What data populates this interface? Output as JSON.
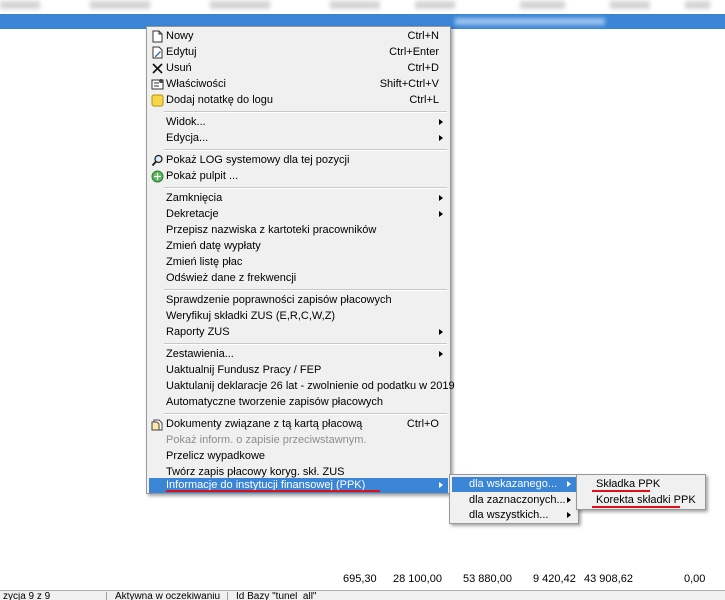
{
  "context_menu": {
    "items": [
      {
        "label": "Nowy",
        "shortcut": "Ctrl+N",
        "icon": "new-document-icon"
      },
      {
        "label": "Edytuj",
        "shortcut": "Ctrl+Enter",
        "icon": "edit-document-icon"
      },
      {
        "label": "Usuń",
        "shortcut": "Ctrl+D",
        "icon": "delete-x-icon"
      },
      {
        "label": "Właściwości",
        "shortcut": "Shift+Ctrl+V",
        "icon": "properties-icon"
      },
      {
        "label": "Dodaj notatkę do logu",
        "shortcut": "Ctrl+L",
        "icon": "note-icon"
      },
      {
        "label": "Widok...",
        "submenu": true
      },
      {
        "label": "Edycja...",
        "submenu": true
      },
      {
        "label": "Pokaż LOG systemowy dla tej pozycji",
        "icon": "magnifier-icon"
      },
      {
        "label": "Pokaż pulpit ...",
        "icon": "desktop-icon"
      },
      {
        "label": "Zamknięcia",
        "submenu": true
      },
      {
        "label": "Dekretacje",
        "submenu": true
      },
      {
        "label": "Przepisz nazwiska z kartoteki pracowników"
      },
      {
        "label": "Zmień datę wypłaty"
      },
      {
        "label": "Zmień listę płac"
      },
      {
        "label": "Odśwież dane z frekwencji"
      },
      {
        "label": "Sprawdzenie poprawności zapisów płacowych"
      },
      {
        "label": "Weryfikuj składki ZUS (E,R,C,W,Z)"
      },
      {
        "label": "Raporty ZUS",
        "submenu": true
      },
      {
        "label": "Zestawienia...",
        "submenu": true
      },
      {
        "label": "Uaktualnij Fundusz Pracy / FEP"
      },
      {
        "label": "Uaktulanij deklaracje 26 lat - zwolnienie od podatku w 2019"
      },
      {
        "label": "Automatyczne tworzenie zapisów płacowych"
      },
      {
        "label": "Dokumenty związane z  tą kartą płacową",
        "shortcut": "Ctrl+O",
        "icon": "documents-icon"
      },
      {
        "label": "Pokaż inform. o zapisie przeciwstawnym.",
        "disabled": true
      },
      {
        "label": "Przelicz wypadkowe"
      },
      {
        "label": "Twórz zapis płacowy koryg. skł. ZUS"
      },
      {
        "label": "Informacje do instytucji finansowej (PPK)",
        "submenu": true,
        "highlighted": true
      }
    ]
  },
  "submenu_ppk": {
    "items": [
      {
        "label": "dla wskazanego...",
        "submenu": true,
        "highlighted": true
      },
      {
        "label": "dla zaznaczonych...",
        "submenu": true
      },
      {
        "label": "dla wszystkich...",
        "submenu": true
      }
    ]
  },
  "submenu_skladka": {
    "items": [
      {
        "label": "Składka PPK"
      },
      {
        "label": "Korekta składki PPK"
      }
    ]
  },
  "totals": [
    "695,30",
    "28 100,00",
    "53 880,00",
    "9 420,42",
    "43 908,62",
    "0,00"
  ],
  "statusbar": {
    "position": "zycja 9 z 9",
    "state": "Aktywna w oczekiwaniu",
    "db": "Id Bazy \"tunel_all\""
  },
  "colors": {
    "highlight": "#3a85d6",
    "menu_bg": "#f0f0f0",
    "annotation_red": "#e0101a"
  }
}
